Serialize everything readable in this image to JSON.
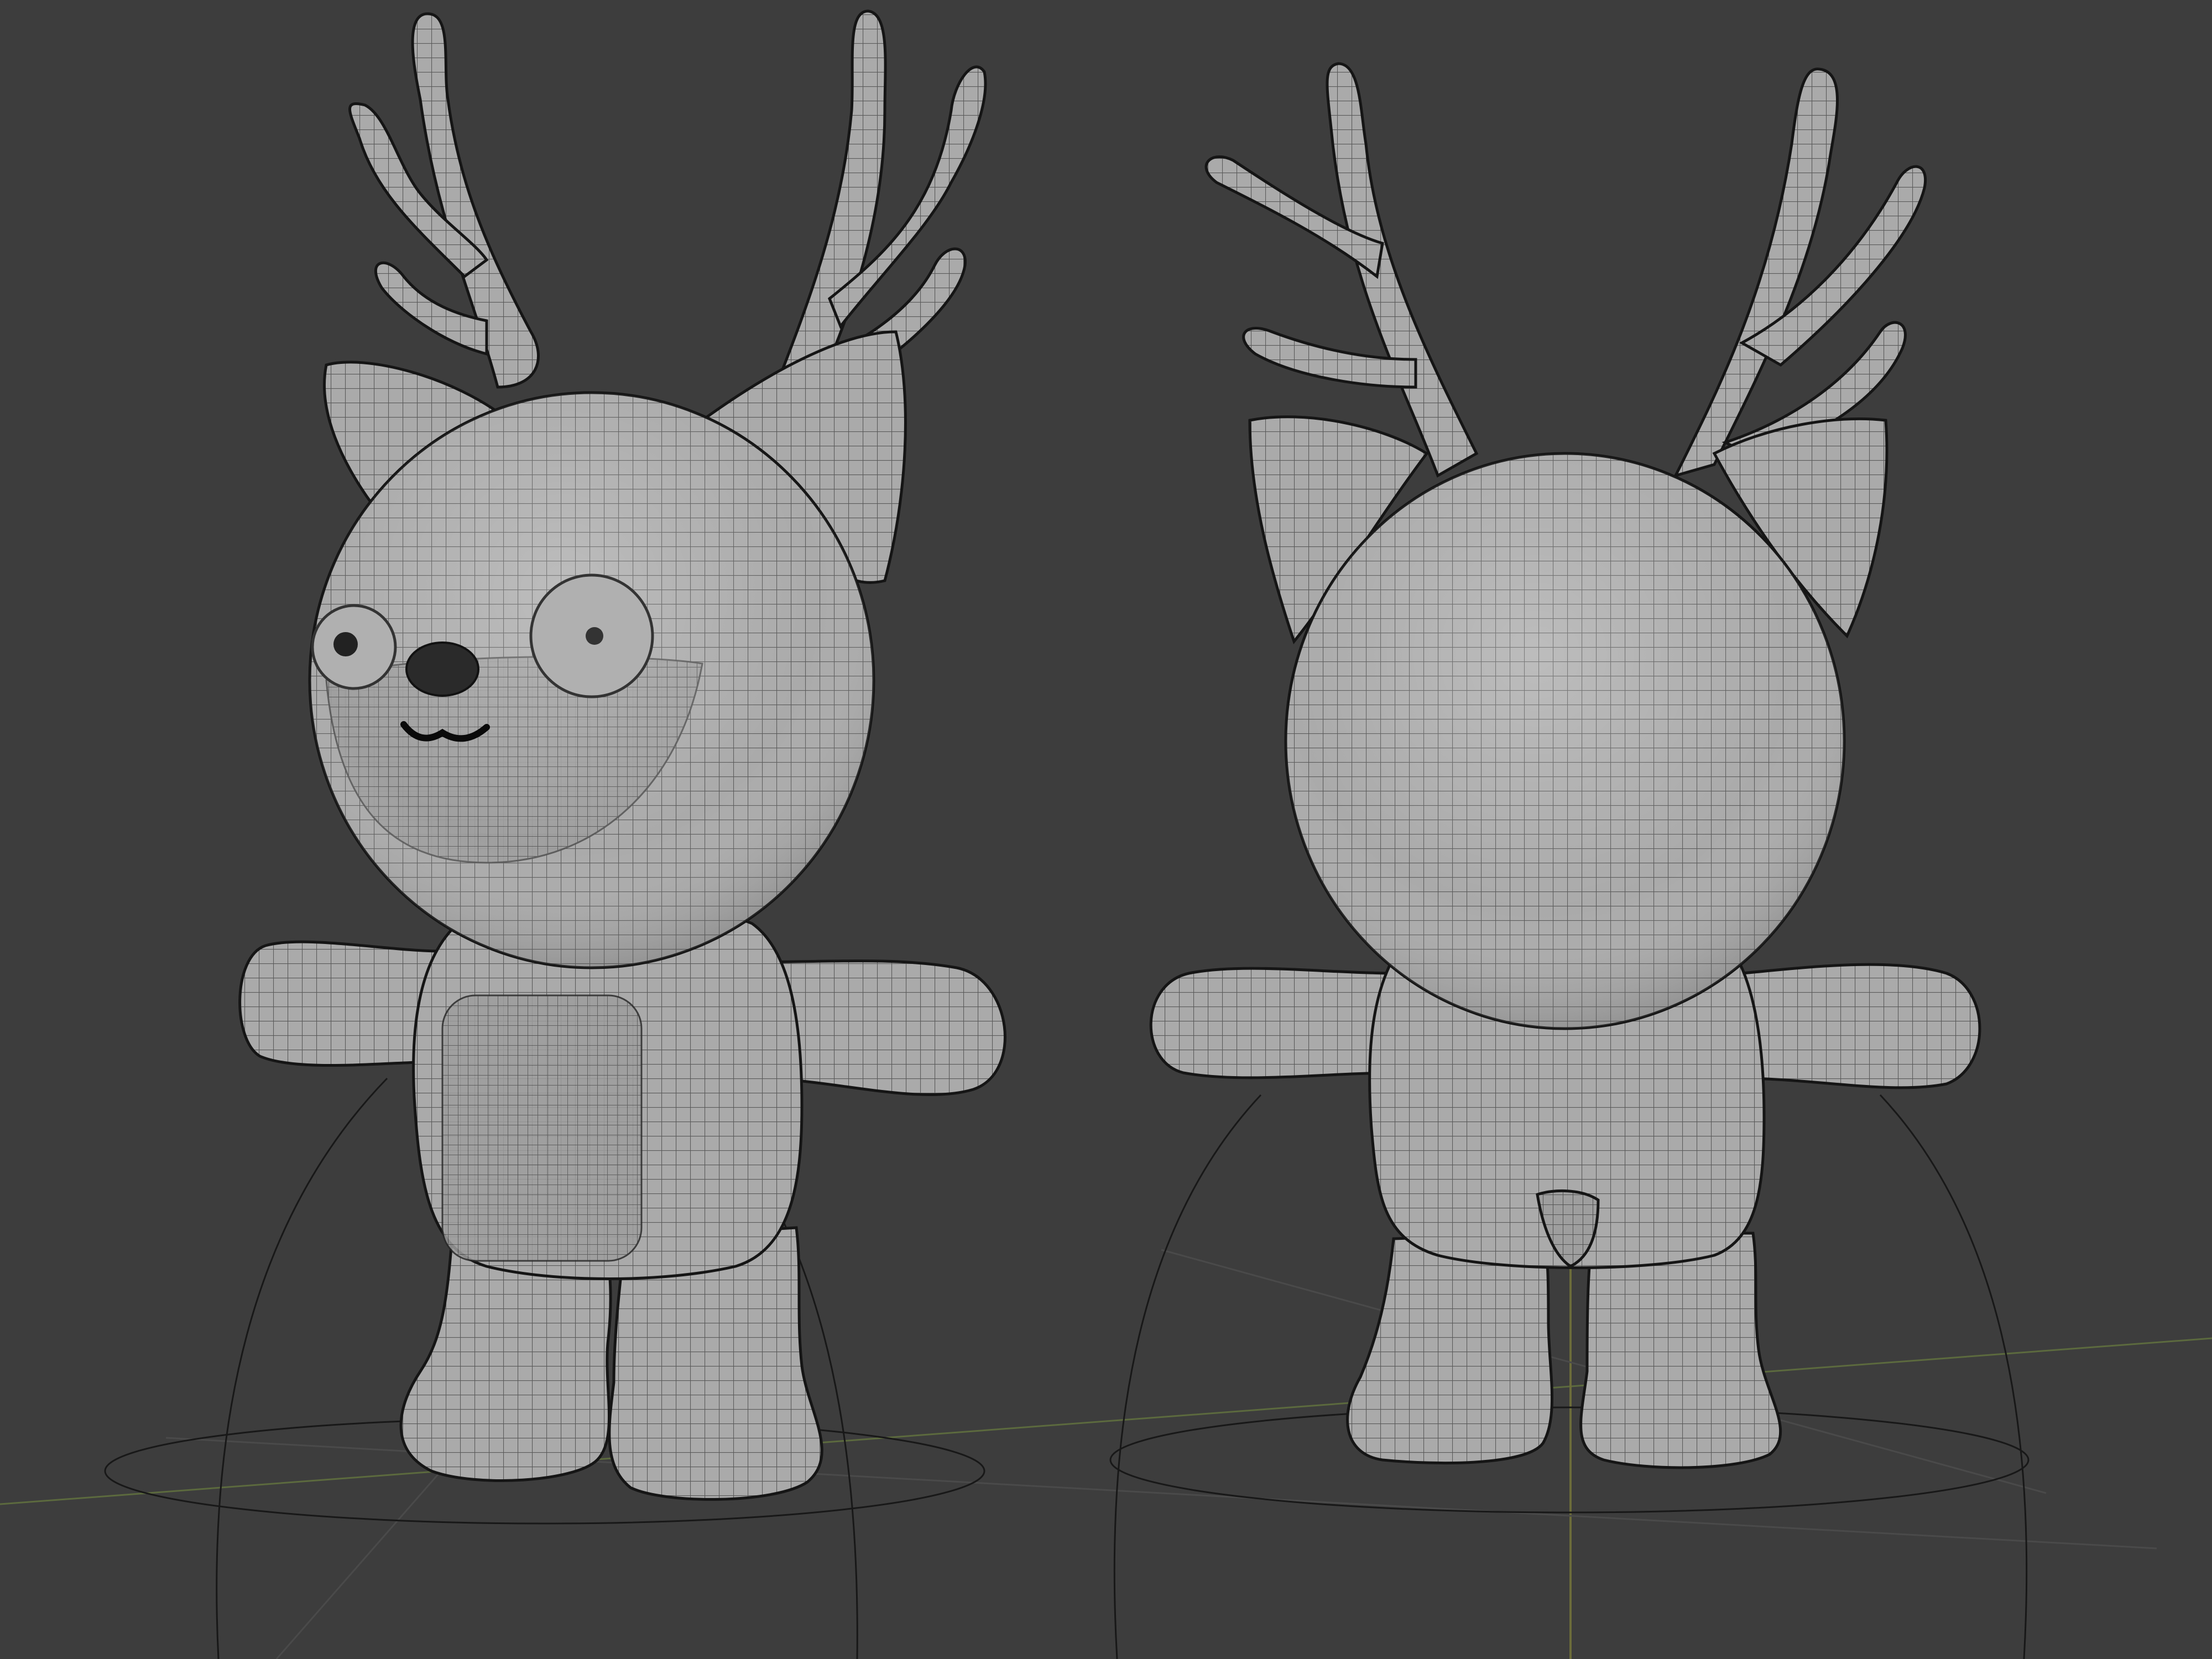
{
  "viewport": {
    "background_color": "#3d3d3d",
    "mesh_color": "#a9a9a9",
    "wire_color": "#4a4a4a",
    "outline_color": "#141414",
    "floor_line_color": "#6a7a4a",
    "axis_line_color": "#7a7a3a"
  },
  "models": {
    "front": {
      "view": "front",
      "description_icon": "deer-plush-front-icon"
    },
    "back": {
      "view": "back",
      "description_icon": "deer-plush-back-icon"
    }
  }
}
